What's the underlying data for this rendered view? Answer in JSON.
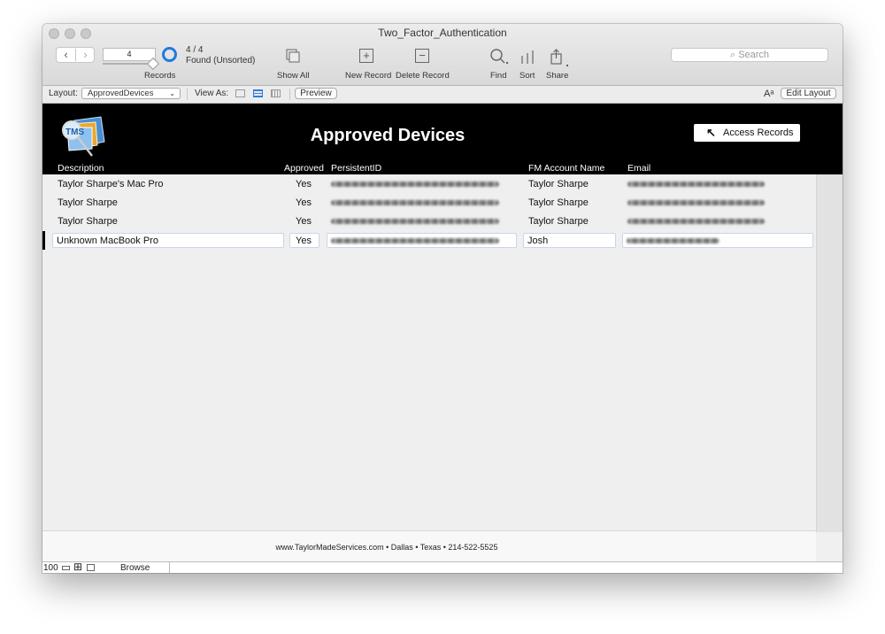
{
  "window": {
    "title": "Two_Factor_Authentication"
  },
  "toolbar": {
    "record_number": "4",
    "records_label": "Records",
    "found_count": "4 / 4",
    "found_status": "Found (Unsorted)",
    "show_all_label": "Show All",
    "new_record_label": "New Record",
    "delete_record_label": "Delete Record",
    "find_label": "Find",
    "sort_label": "Sort",
    "share_label": "Share",
    "search_placeholder": "Search"
  },
  "layout_bar": {
    "layout_label": "Layout:",
    "layout_value": "ApprovedDevices",
    "view_as_label": "View As:",
    "preview_label": "Preview",
    "font_size_glyph": "Aᵃ",
    "edit_layout_label": "Edit Layout"
  },
  "header": {
    "title": "Approved Devices",
    "access_records_label": "Access Records",
    "columns": {
      "description": "Description",
      "approved": "Approved",
      "persistent_id": "PersistentID",
      "fm_account_name": "FM Account Name",
      "email": "Email"
    }
  },
  "rows": [
    {
      "description": "Taylor Sharpe's Mac Pro",
      "approved": "Yes",
      "fm_account_name": "Taylor Sharpe"
    },
    {
      "description": "Taylor Sharpe",
      "approved": "Yes",
      "fm_account_name": "Taylor Sharpe"
    },
    {
      "description": "Taylor Sharpe",
      "approved": "Yes",
      "fm_account_name": "Taylor Sharpe"
    },
    {
      "description": "Unknown MacBook Pro",
      "approved": "Yes",
      "fm_account_name": "Josh"
    }
  ],
  "footer": {
    "text": "www.TaylorMadeServices.com • Dallas • Texas • 214-522-5525"
  },
  "status_bar": {
    "zoom": "100",
    "mode": "Browse"
  },
  "colors": {
    "accent": "#1f7ae0",
    "header_band": "#000000",
    "body": "#efefef"
  }
}
